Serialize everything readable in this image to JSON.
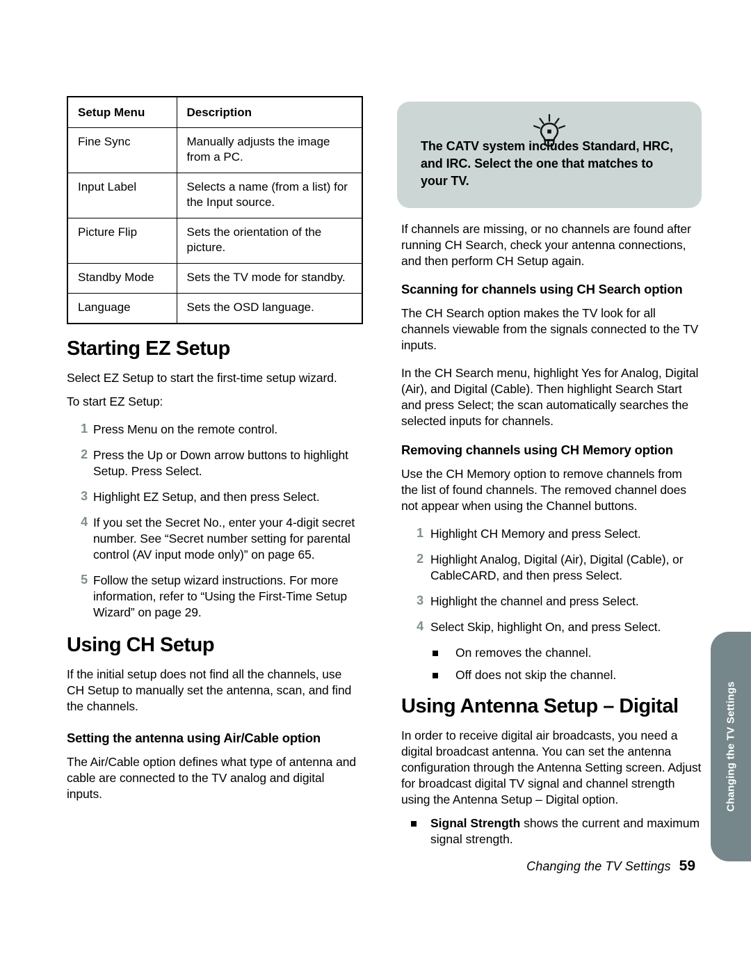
{
  "page": {
    "number": "59",
    "footer_title": "Changing the TV Settings",
    "side_tab_label": "Changing the TV Settings",
    "colors": {
      "callout_bg": "#ccd6d5",
      "side_tab_bg": "#75878a",
      "step_number": "#7e8e8c"
    }
  },
  "table": {
    "headers": [
      "Setup Menu",
      "Description"
    ],
    "rows": [
      [
        "Fine Sync",
        "Manually adjusts the image from a PC."
      ],
      [
        "Input Label",
        "Selects a name (from a list) for the Input source."
      ],
      [
        "Picture Flip",
        "Sets the orientation of the picture."
      ],
      [
        "Standby Mode",
        "Sets the TV mode for standby."
      ],
      [
        "Language",
        "Sets the OSD language."
      ]
    ]
  },
  "left_column": {
    "heading_ez": "Starting EZ Setup",
    "ez_intro": "Select EZ Setup to start the first-time setup wizard.",
    "ez_lead": "To start EZ Setup:",
    "ez_steps": [
      {
        "num": "1",
        "text": "Press Menu on the remote control."
      },
      {
        "num": "2",
        "text": "Press the Up or Down arrow buttons to highlight Setup. Press Select."
      },
      {
        "num": "3",
        "text": "Highlight EZ Setup, and then press Select."
      },
      {
        "num": "4",
        "text": "If you set the Secret No., enter your 4-digit secret number. See “Secret number setting for parental control (AV input mode only)” on page 65."
      },
      {
        "num": "5",
        "text": "Follow the setup wizard instructions. For more information, refer to “Using the First-Time Setup Wizard” on page 29."
      }
    ],
    "heading_ch_setup": "Using CH Setup",
    "ch_setup_intro": "If the initial setup does not find all the channels, use CH Setup to manually set the antenna, scan, and find the channels.",
    "subheading_antenna": "Setting the antenna using Air/Cable option",
    "antenna_body": "The Air/Cable option defines what type of antenna and cable are connected to the TV analog and digital inputs."
  },
  "right_column": {
    "callout": {
      "icon": "lightbulb-icon",
      "text": "The CATV system includes Standard, HRC, and IRC. Select the one that matches to your TV."
    },
    "missing_channels": "If channels are missing, or no channels are found after running CH Search, check your antenna connections, and then perform CH Setup again.",
    "subheading_search": "Scanning for channels using CH Search option",
    "search_body_1": "The CH Search option makes the TV look for all channels viewable from the signals connected to the TV inputs.",
    "search_body_2": "In the CH Search menu, highlight Yes for Analog, Digital (Air), and Digital (Cable). Then highlight Search Start and press Select; the scan automatically searches the selected inputs for channels.",
    "subheading_memory": "Removing channels using CH Memory option",
    "memory_body": "Use the CH Memory option to remove channels from the list of found channels. The removed channel does not appear when using the Channel buttons.",
    "memory_steps": [
      {
        "num": "1",
        "text": "Highlight CH Memory and press Select."
      },
      {
        "num": "2",
        "text": "Highlight Analog, Digital (Air), Digital (Cable), or CableCARD, and then press Select."
      },
      {
        "num": "3",
        "text": "Highlight the channel and press Select."
      },
      {
        "num": "4",
        "text": "Select Skip, highlight On, and press Select."
      }
    ],
    "memory_bullets": [
      "On removes the channel.",
      "Off does not skip the channel."
    ],
    "heading_antenna_digital": "Using Antenna Setup – Digital",
    "antenna_digital_body": "In order to receive digital air broadcasts, you need a digital broadcast antenna. You can set the antenna configuration through the Antenna Setting screen. Adjust for broadcast digital TV signal and channel strength using the Antenna Setup – Digital option.",
    "signal_strength_bold": "Signal Strength",
    "signal_strength_rest": " shows the current and maximum signal strength."
  }
}
